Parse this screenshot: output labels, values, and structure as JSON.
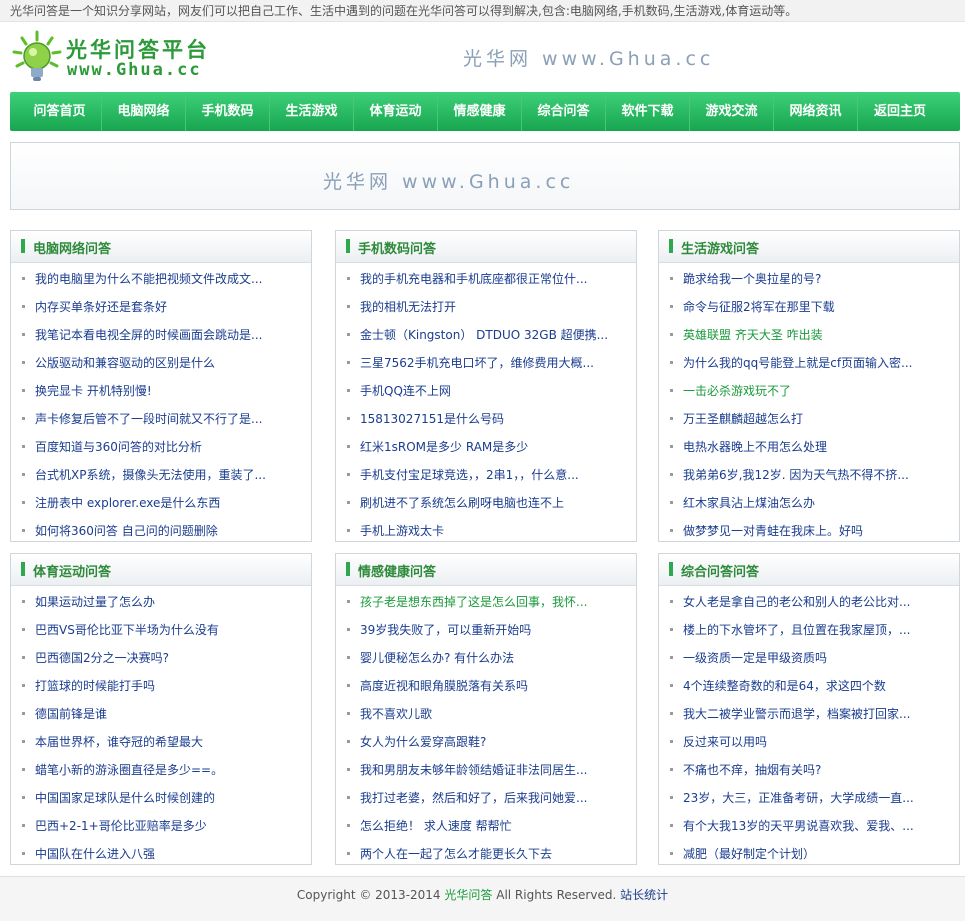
{
  "topbar": {
    "text": "光华问答是一个知识分享网站，网友们可以把自己工作、生活中遇到的问题在光华问答可以得到解决,包含:电脑网络,手机数码,生活游戏,体育运动等。"
  },
  "header": {
    "logo_title": "光华问答平台",
    "logo_sub": "www.Ghua.cc",
    "slogan": "光华网 www.Ghua.cc"
  },
  "nav": [
    "问答首页",
    "电脑网络",
    "手机数码",
    "生活游戏",
    "体育运动",
    "情感健康",
    "综合问答",
    "软件下载",
    "游戏交流",
    "网络资讯",
    "返回主页"
  ],
  "banner": {
    "text": "光华网  www.Ghua.cc"
  },
  "colors": {
    "accent": "#2da84e",
    "link": "#1a3d8f",
    "link_green": "#1a9a3a",
    "nav_top": "#3fd07a",
    "nav_bottom": "#18a54f"
  },
  "panels": [
    {
      "title": "电脑网络问答",
      "items": [
        {
          "text": "我的电脑里为什么不能把视频文件改成文...",
          "green": false
        },
        {
          "text": "内存买单条好还是套条好",
          "green": false
        },
        {
          "text": "我笔记本看电视全屏的时候画面会跳动是...",
          "green": false
        },
        {
          "text": "公版驱动和兼容驱动的区别是什么",
          "green": false
        },
        {
          "text": "换完显卡 开机特别慢!",
          "green": false
        },
        {
          "text": "声卡修复后管不了一段时间就又不行了是...",
          "green": false
        },
        {
          "text": "百度知道与360问答的对比分析",
          "green": false
        },
        {
          "text": "台式机XP系统，摄像头无法使用，重装了...",
          "green": false
        },
        {
          "text": "注册表中 explorer.exe是什么东西",
          "green": false
        },
        {
          "text": "如何将360问答 自己问的问题删除",
          "green": false
        }
      ]
    },
    {
      "title": "手机数码问答",
      "items": [
        {
          "text": "我的手机充电器和手机底座都很正常位什...",
          "green": false
        },
        {
          "text": "我的相机无法打开",
          "green": false
        },
        {
          "text": "金士顿（Kingston） DTDUO 32GB 超便携...",
          "green": false
        },
        {
          "text": "三星7562手机充电口坏了，维修费用大概...",
          "green": false
        },
        {
          "text": "手机QQ连不上网",
          "green": false
        },
        {
          "text": "15813027151是什么号码",
          "green": false
        },
        {
          "text": "红米1sROM是多少 RAM是多少",
          "green": false
        },
        {
          "text": "手机支付宝足球竞选，，2串1，，什么意...",
          "green": false
        },
        {
          "text": "刷机进不了系统怎么刷呀电脑也连不上",
          "green": false
        },
        {
          "text": "手机上游戏太卡",
          "green": false
        }
      ]
    },
    {
      "title": "生活游戏问答",
      "items": [
        {
          "text": "跪求给我一个奥拉星的号?",
          "green": false
        },
        {
          "text": "命令与征服2将军在那里下载",
          "green": false
        },
        {
          "text": "英雄联盟 齐天大圣 咋出装",
          "green": true
        },
        {
          "text": "为什么我的qq号能登上就是cf页面输入密...",
          "green": false
        },
        {
          "text": "一击必杀游戏玩不了",
          "green": true
        },
        {
          "text": "万王圣麒麟超越怎么打",
          "green": false
        },
        {
          "text": "电热水器晚上不用怎么处理",
          "green": false
        },
        {
          "text": "我弟弟6岁,我12岁. 因为天气热不得不挤...",
          "green": false
        },
        {
          "text": "红木家具沾上煤油怎么办",
          "green": false
        },
        {
          "text": "做梦梦见一对青蛙在我床上。好吗",
          "green": false
        }
      ]
    },
    {
      "title": "体育运动问答",
      "items": [
        {
          "text": "如果运动过量了怎么办",
          "green": false
        },
        {
          "text": "巴西VS哥伦比亚下半场为什么没有",
          "green": false
        },
        {
          "text": "巴西德国2分之一决赛吗?",
          "green": false
        },
        {
          "text": "打篮球的时候能打手吗",
          "green": false
        },
        {
          "text": "德国前锋是谁",
          "green": false
        },
        {
          "text": "本届世界杯，谁夺冠的希望最大",
          "green": false
        },
        {
          "text": "蜡笔小新的游泳圈直径是多少==。",
          "green": false
        },
        {
          "text": "中国国家足球队是什么时候创建的",
          "green": false
        },
        {
          "text": "巴西+2-1+哥伦比亚赔率是多少",
          "green": false
        },
        {
          "text": "中国队在什么进入八强",
          "green": false
        }
      ]
    },
    {
      "title": "情感健康问答",
      "items": [
        {
          "text": "孩子老是想东西掉了这是怎么回事，我怀...",
          "green": true
        },
        {
          "text": "39岁我失败了，可以重新开始吗",
          "green": false
        },
        {
          "text": "婴儿便秘怎么办? 有什么办法",
          "green": false
        },
        {
          "text": "高度近视和眼角膜脱落有关系吗",
          "green": false
        },
        {
          "text": "我不喜欢儿歌",
          "green": false
        },
        {
          "text": "女人为什么爱穿高跟鞋?",
          "green": false
        },
        {
          "text": "我和男朋友未够年龄领结婚证非法同居生...",
          "green": false
        },
        {
          "text": "我打过老婆，然后和好了，后来我问她爱...",
          "green": false
        },
        {
          "text": "怎么拒绝！ 求人速度 帮帮忙",
          "green": false
        },
        {
          "text": "两个人在一起了怎么才能更长久下去",
          "green": false
        }
      ]
    },
    {
      "title": "综合问答问答",
      "items": [
        {
          "text": "女人老是拿自己的老公和别人的老公比对...",
          "green": false
        },
        {
          "text": "楼上的下水管坏了，且位置在我家屋顶，...",
          "green": false
        },
        {
          "text": "一级资质一定是甲级资质吗",
          "green": false
        },
        {
          "text": "4个连续整奇数的和是64，求这四个数",
          "green": false
        },
        {
          "text": "我大二被学业警示而退学，档案被打回家...",
          "green": false
        },
        {
          "text": "反过来可以用吗",
          "green": false
        },
        {
          "text": "不痛也不痒，抽烟有关吗?",
          "green": false
        },
        {
          "text": "23岁，大三，正准备考研，大学成绩一直...",
          "green": false
        },
        {
          "text": "有个大我13岁的天平男说喜欢我、爱我、...",
          "green": false
        },
        {
          "text": "减肥（最好制定个计划）",
          "green": false
        }
      ]
    }
  ],
  "footer": {
    "copyright": "Copyright © 2013-2014",
    "site": "光华问答",
    "rights": "All Rights Reserved.",
    "stats": "站长统计"
  }
}
